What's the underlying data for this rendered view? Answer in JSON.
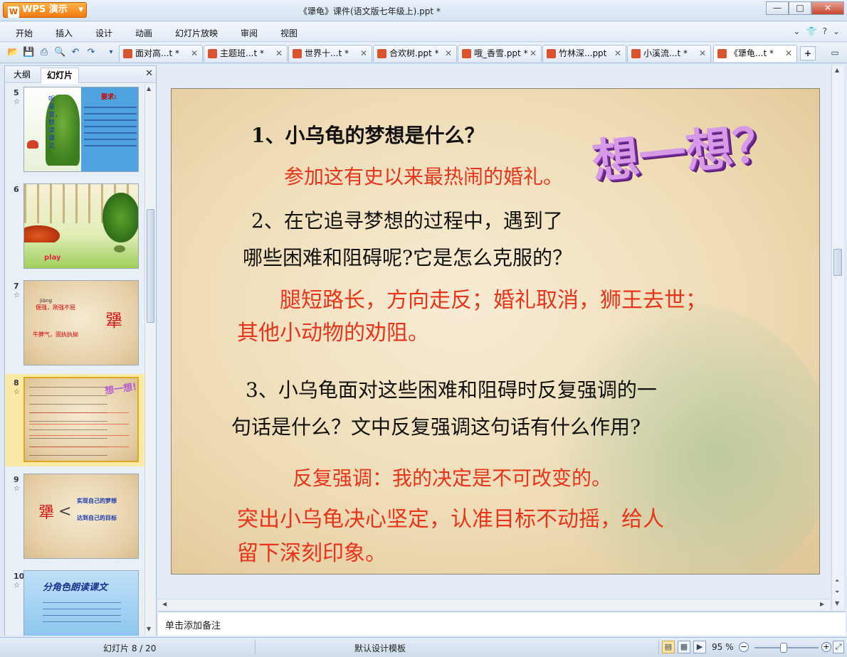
{
  "app": {
    "button_label": "WPS 演示",
    "doc_title": "《犟龟》课件(语文版七年级上).ppt *"
  },
  "window_controls": {
    "minimize": "—",
    "restore": "□",
    "close": "✕"
  },
  "menu": {
    "items": [
      "开始",
      "插入",
      "设计",
      "动画",
      "幻灯片放映",
      "审阅",
      "视图"
    ],
    "right": [
      "⌄",
      "👕",
      "?",
      "⌄"
    ]
  },
  "doc_tabs": [
    {
      "label": "面对高...t *"
    },
    {
      "label": "主题班...t *"
    },
    {
      "label": "世界十...t *"
    },
    {
      "label": "合欢树.ppt *"
    },
    {
      "label": "哦_香雪.ppt *"
    },
    {
      "label": "竹林深...ppt"
    },
    {
      "label": "小溪流...t *"
    },
    {
      "label": "《犟龟...t *"
    }
  ],
  "tab_close": "✕",
  "left_panel": {
    "tabs": [
      "大纲",
      "幻灯片"
    ],
    "close": "✕",
    "slides": [
      {
        "num": "5",
        "t1": "要求:",
        "t2": "听录音，默读课文",
        "t3": "play"
      },
      {
        "num": "6",
        "t1": "play"
      },
      {
        "num": "7",
        "t1": "jiàng",
        "t2": "倔强，刚强不屈",
        "t3": "犟",
        "t4": "牛脾气，固执执拗"
      },
      {
        "num": "8",
        "t1": "想一想!"
      },
      {
        "num": "9",
        "t1": "犟",
        "t2": "实现自己的梦想",
        "t3": "达到自己的目标"
      },
      {
        "num": "10",
        "t1": "分角色朗读课文"
      }
    ]
  },
  "slide": {
    "q1": "1、小乌龟的梦想是什么？",
    "a1": "参加这有史以来最热闹的婚礼。",
    "q2_line1": "2、在它追寻梦想的过程中，遇到了",
    "q2_line2": "哪些困难和阻碍呢?它是怎么克服的？",
    "a2_line1": "腿短路长，方向走反；婚礼取消，狮王去世；",
    "a2_line2": "其他小动物的劝阻。",
    "q3_line1": "3、小乌龟面对这些困难和阻碍时反复强调的一",
    "q3_line2": "句话是什么？文中反复强调这句话有什么作用?",
    "a3_line1": "反复强调：我的决定是不可改变的。",
    "a3_line2": "突出小乌龟决心坚定，认准目标不动摇，给人",
    "a3_line3": "留下深刻印象。",
    "wordart": "想一想？"
  },
  "notes_placeholder": "单击添加备注",
  "status": {
    "slide_info": "幻灯片 8 / 20",
    "theme": "默认设计模板",
    "zoom": "95 %"
  }
}
